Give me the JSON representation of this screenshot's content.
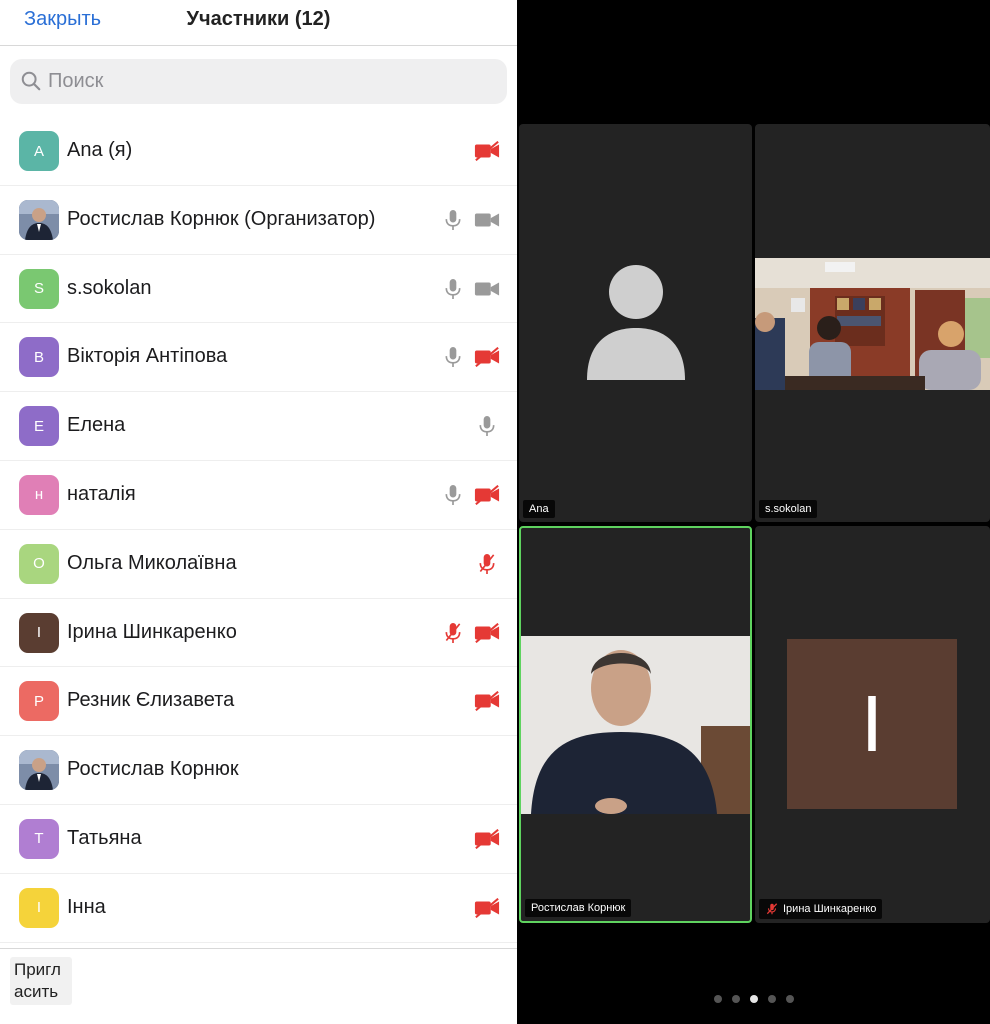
{
  "header": {
    "close_label": "Закрыть",
    "title": "Участники (12)"
  },
  "search": {
    "placeholder": "Поиск",
    "value": ""
  },
  "participants": [
    {
      "initial": "A",
      "name": "Ana (я)",
      "color": "#5bb5a6",
      "photo": false,
      "mic": "none",
      "cam": "off"
    },
    {
      "initial": "",
      "name": "Ростислав Корнюк (Организатор)",
      "color": "#5b6d85",
      "photo": true,
      "mic": "on",
      "cam": "on"
    },
    {
      "initial": "S",
      "name": "s.sokolan",
      "color": "#7ac871",
      "photo": false,
      "mic": "on",
      "cam": "on"
    },
    {
      "initial": "B",
      "name": "Вікторія Антіпова",
      "color": "#8e6cc8",
      "photo": false,
      "mic": "on",
      "cam": "off"
    },
    {
      "initial": "E",
      "name": "Елена",
      "color": "#8e6cc8",
      "photo": false,
      "mic": "on",
      "cam": "none"
    },
    {
      "initial": "н",
      "name": "наталія",
      "color": "#e07fb6",
      "photo": false,
      "mic": "on",
      "cam": "off"
    },
    {
      "initial": "O",
      "name": "Ольга Миколаївна",
      "color": "#a9d67f",
      "photo": false,
      "mic": "off",
      "cam": "none"
    },
    {
      "initial": "I",
      "name": "Ірина Шинкаренко",
      "color": "#5a3d31",
      "photo": false,
      "mic": "off",
      "cam": "off"
    },
    {
      "initial": "P",
      "name": "Резник Єлизавета",
      "color": "#ec6a63",
      "photo": false,
      "mic": "none",
      "cam": "off"
    },
    {
      "initial": "",
      "name": "Ростислав Корнюк",
      "color": "#5b6d85",
      "photo": true,
      "mic": "none",
      "cam": "none"
    },
    {
      "initial": "T",
      "name": "Татьяна",
      "color": "#b07ed2",
      "photo": false,
      "mic": "none",
      "cam": "off"
    },
    {
      "initial": "I",
      "name": "Інна",
      "color": "#f5d33a",
      "photo": false,
      "mic": "none",
      "cam": "off"
    }
  ],
  "footer": {
    "invite_label": "Пригласить"
  },
  "videos": {
    "tile1_label": "Ana",
    "tile2_label": "s.sokolan",
    "tile3_label": "Ростислав Корнюк",
    "tile4_label": "Ірина Шинкаренко",
    "tile4_initial": "I",
    "tile4_color": "#5a3d31"
  },
  "pager": {
    "count": 5,
    "active": 2
  },
  "colors": {
    "accent": "#2a6fd6",
    "muted_red": "#e53935",
    "active_speaker": "#5fd35f"
  }
}
